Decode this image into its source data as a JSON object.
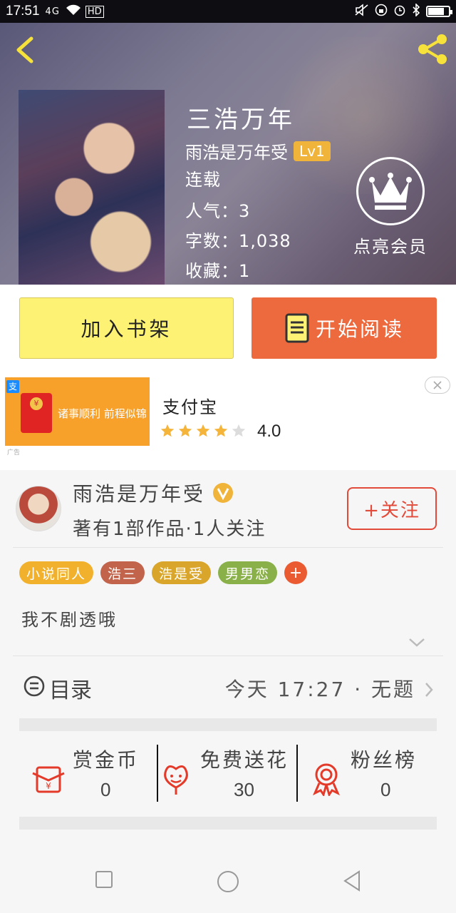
{
  "status_bar": {
    "time": "17:51",
    "network": "4G",
    "hd": "HD",
    "battery_level": 0.8
  },
  "book": {
    "title": "三浩万年",
    "author": "雨浩是万年受",
    "level": "Lv1",
    "status": "连载",
    "popularity": "人气：3",
    "word_count": "字数：1,038",
    "favorites": "收藏：1",
    "vip_label": "点亮会员"
  },
  "actions": {
    "add_shelf": "加入书架",
    "start_reading": "开始阅读"
  },
  "ad": {
    "app_name": "支付宝",
    "rating": "4.0",
    "rating_value": 4.0,
    "image_slogan": "诸事顺利 前程似锦",
    "image_subtext": "广告"
  },
  "author_card": {
    "name": "雨浩是万年受",
    "stats": "著有1部作品·1人关注",
    "follow_label": "+关注"
  },
  "tags": [
    {
      "label": "小说同人",
      "color": "#f2b12c"
    },
    {
      "label": "浩三",
      "color": "#c2644c"
    },
    {
      "label": "浩是受",
      "color": "#d9a52a"
    },
    {
      "label": "男男恋",
      "color": "#8ab04a"
    }
  ],
  "tag_add": "+",
  "description": "我不剧透哦",
  "toc": {
    "label": "目录",
    "latest": "今天 17:27 · 无题"
  },
  "stats": {
    "reward_label": "赏金币",
    "reward_value": "0",
    "flower_label": "免费送花",
    "flower_value": "30",
    "fans_label": "粉丝榜",
    "fans_value": "0"
  },
  "colors": {
    "accent_orange": "#ed6a3e",
    "shelf_yellow": "#fef274",
    "follow_red": "#e24a3a",
    "lv_badge": "#f0b43a"
  }
}
